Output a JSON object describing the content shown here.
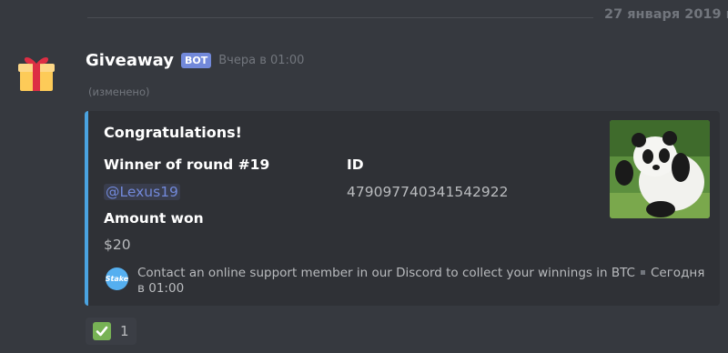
{
  "date_divider": "27 января 2019 г",
  "message": {
    "username": "Giveaway",
    "bot_tag": "BOT",
    "timestamp": "Вчера в 01:00",
    "edited": "(изменено)",
    "avatar_icon": "gift-icon"
  },
  "embed": {
    "accent_color": "#4aa3e0",
    "title": "Congratulations!",
    "fields": [
      {
        "name": "Winner of round #19",
        "value": "@Lexus19"
      },
      {
        "name": "ID",
        "value": "479097740341542922"
      },
      {
        "name": "Amount won",
        "value": "$20"
      }
    ],
    "thumbnail": "panda-image",
    "footer": {
      "icon_text": "Stake",
      "text": "Contact an online support member in our Discord to collect your winnings in BTC",
      "timestamp": "Сегодня в 01:00"
    }
  },
  "reaction": {
    "emoji": "white-check-mark-icon",
    "count": "1"
  }
}
